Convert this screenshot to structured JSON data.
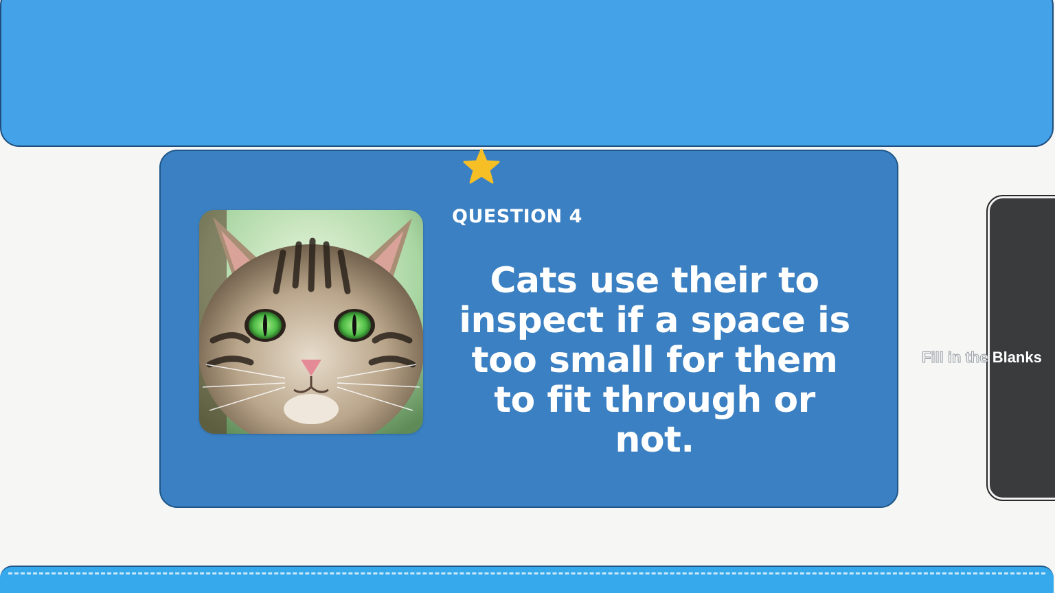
{
  "question": {
    "label": "QUESTION 4",
    "text": "Cats use their to inspect if a space is too small for them to fit through or not."
  },
  "side_panel": {
    "label_faded": "Fill in the",
    "label": "Blanks"
  },
  "image": {
    "subject": "tabby cat with green eyes"
  },
  "colors": {
    "banner": "#44a2e9",
    "card": "#3b80c2",
    "star": "#f6bf26",
    "panel": "#3a3b3c",
    "bottom_bar": "#36a8ec"
  },
  "icons": {
    "star": "star-icon"
  }
}
